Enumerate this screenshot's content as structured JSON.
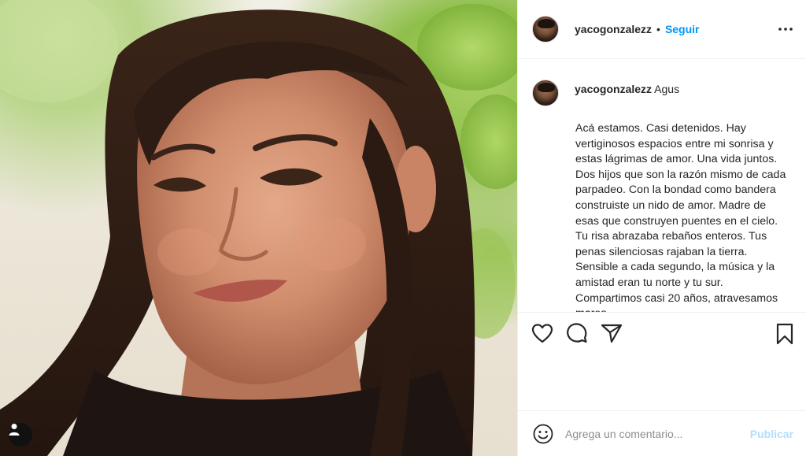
{
  "post": {
    "photo_alt": "",
    "user_tag_icon": "user-silhouette-icon"
  },
  "header": {
    "username": "yacogonzalezz",
    "separator": "•",
    "follow_label": "Seguir",
    "more_icon": "ellipsis-icon",
    "more_label": "•••"
  },
  "caption": {
    "username": "yacogonzalezz",
    "tag": "Agus",
    "text": "Acá estamos. Casi detenidos. Hay vertiginosos espacios entre mi sonrisa y estas lágrimas de amor. Una vida juntos. Dos hijos que son la razón mismo de cada parpadeo. Con la bondad como bandera construiste un nido de amor. Madre de esas que construyen puentes en el cielo. Tu risa abrazaba rebaños enteros. Tus penas silenciosas rajaban la tierra. Sensible a cada segundo, la música y la amistad eran tu norte y tu sur. Compartimos casi 20 años, atravesamos mares"
  },
  "actions": {
    "like_icon": "heart-icon",
    "comment_icon": "comment-bubble-icon",
    "share_icon": "paper-plane-icon",
    "save_icon": "bookmark-icon"
  },
  "comment": {
    "emoji_icon": "smiley-icon",
    "placeholder": "Agrega un comentario...",
    "publish_label": "Publicar"
  },
  "colors": {
    "accent": "#0095f6",
    "publish_disabled": "#b2dffc",
    "text": "#262626",
    "muted": "#8e8e8e",
    "border": "#efefef"
  }
}
